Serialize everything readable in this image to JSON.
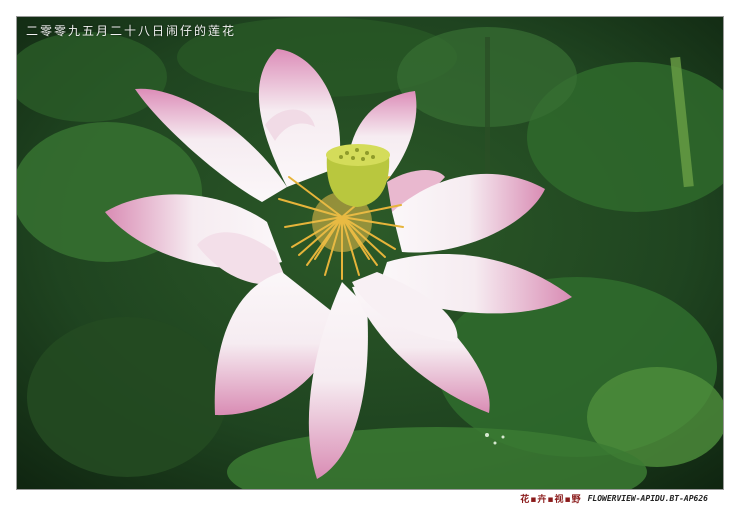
{
  "photo": {
    "subject": "pink-white lotus flower with yellow seed pod and stamens over green lotus leaves",
    "colors": {
      "background": "#1d3a1c",
      "leaf": "#2f6a2c",
      "leaf_light": "#4f8f3c",
      "petal": "#f6ecf1",
      "petal_tip": "#d98cb4",
      "pod": "#c9d64a",
      "stamen": "#e6b43a"
    }
  },
  "caption": {
    "text": "二零零九五月二十八日闹仔的莲花"
  },
  "signature": {
    "chinese": "花▪卉▪视▪野",
    "url": "FLOWERVIEW-APIDU.BT-AP626"
  }
}
